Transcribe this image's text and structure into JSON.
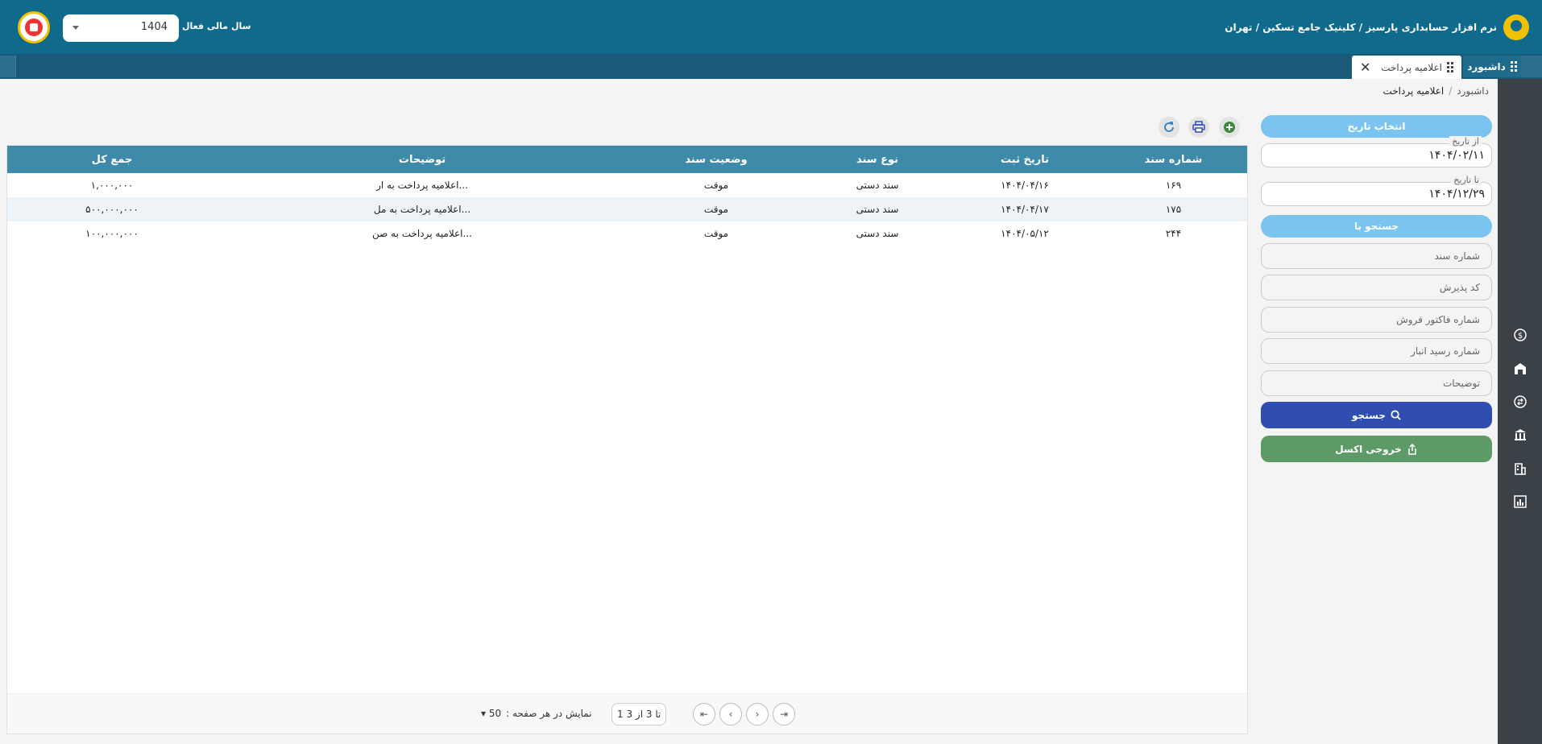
{
  "header": {
    "brand_text": "نرم افزار حسابداری پارسیز / کلینیک جامع تسکین / تهران",
    "fiscal_year_label": "سال مالی فعال",
    "fiscal_year_value": "1404"
  },
  "tabs": {
    "dashboard": "داشبورد",
    "active": "اعلامیه پرداخت"
  },
  "breadcrumb": {
    "home": "داشبورد",
    "separator": "/",
    "current": "اعلامیه پرداخت"
  },
  "filter": {
    "date_select_label": "انتخاب تاریخ",
    "from_label": "از تاریخ",
    "from_value": "۱۴۰۴/۰۲/۱۱",
    "to_label": "تا تاریخ",
    "to_value": "۱۴۰۴/۱۲/۲۹",
    "search_by_label": "جستجو با",
    "doc_number_placeholder": "شماره سند",
    "accept_code_placeholder": "کد پذیرش",
    "invoice_number_placeholder": "شماره فاکتور فروش",
    "warehouse_receipt_placeholder": "شماره رسید انبار",
    "description_placeholder": "توضیحات",
    "search_button": "جستجو",
    "excel_button": "خروجی اکسل"
  },
  "table": {
    "columns": [
      "شماره سند",
      "تاریخ ثبت",
      "نوع سند",
      "وضعیت سند",
      "توضیحات",
      "جمع کل"
    ],
    "rows": [
      [
        "۱۶۹",
        "۱۴۰۴/۰۴/۱۶",
        "سند دستی",
        "موقت",
        "اعلامیه پرداخت به ار...",
        "۱,۰۰۰,۰۰۰"
      ],
      [
        "۱۷۵",
        "۱۴۰۴/۰۴/۱۷",
        "سند دستی",
        "موقت",
        "اعلامیه پرداخت به مل...",
        "۵۰۰,۰۰۰,۰۰۰"
      ],
      [
        "۲۴۴",
        "۱۴۰۴/۰۵/۱۲",
        "سند دستی",
        "موقت",
        "اعلامیه پرداخت به صن...",
        "۱۰۰,۰۰۰,۰۰۰"
      ]
    ]
  },
  "pager": {
    "page_size_label": "نمایش در هر صفحه :",
    "page_size_value": "50",
    "info": "1 تا 3 از 3"
  },
  "colors": {
    "header": "#0f6a8c",
    "table_header": "#3e8aa8",
    "search_button": "#2f4eb0",
    "excel_button": "#5e9a67",
    "pill": "#7cc4f0",
    "sidebar": "#3a4147"
  },
  "icons": {
    "sidebar": [
      "dollar-icon",
      "warehouse-icon",
      "exchange-icon",
      "bank-icon",
      "building-icon",
      "chart-icon"
    ],
    "toolbar": [
      "add-icon",
      "print-icon",
      "refresh-icon"
    ]
  }
}
